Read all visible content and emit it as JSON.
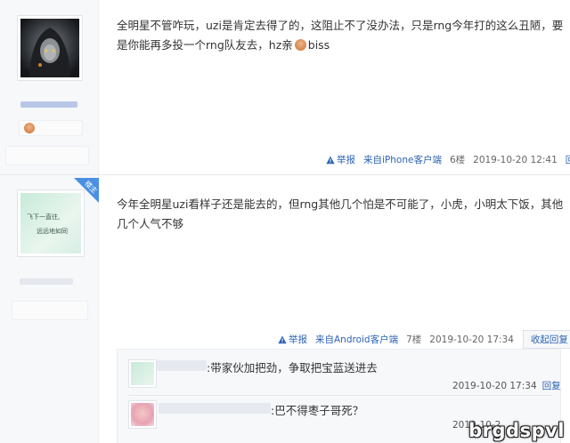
{
  "posts": [
    {
      "text_line1": "全明星不管咋玩，uzi是肯定去得了的，这阻止不了没办法，只是rng今年打的这么丑陋，要",
      "text_line2_a": "是你能再多投一个rng队友去，hz亲",
      "text_line2_b": "biss",
      "report": "举报",
      "client": "来自iPhone客户端",
      "floor": "6楼",
      "time": "2019-10-20 12:41",
      "reply": "回复"
    },
    {
      "badge": "楼主",
      "text_line1": "今年全明星uzi看样子还是能去的，但rng其他几个怕是不可能了，小虎，小明太下饭，其他",
      "text_line2": "几个人气不够",
      "report": "举报",
      "client": "来自Android客户端",
      "floor": "7楼",
      "time": "2019-10-20 17:34",
      "collapse": "收起回复"
    }
  ],
  "sub_replies": [
    {
      "text": ":带家伙加把劲，争取把宝蓝送进去",
      "time": "2019-10-20 17:34",
      "reply": "回复"
    },
    {
      "text": ":巴不得枣子哥死？",
      "time": "2019-10-2"
    }
  ],
  "avatar2_text_line1": "飞下一直往,",
  "avatar2_text_line2": "远远地如同",
  "watermark": "brgdspvl",
  "colors": {
    "link": "#2d64b3",
    "badge": "#4a90e2",
    "sidebar": "#f7f8fa"
  }
}
